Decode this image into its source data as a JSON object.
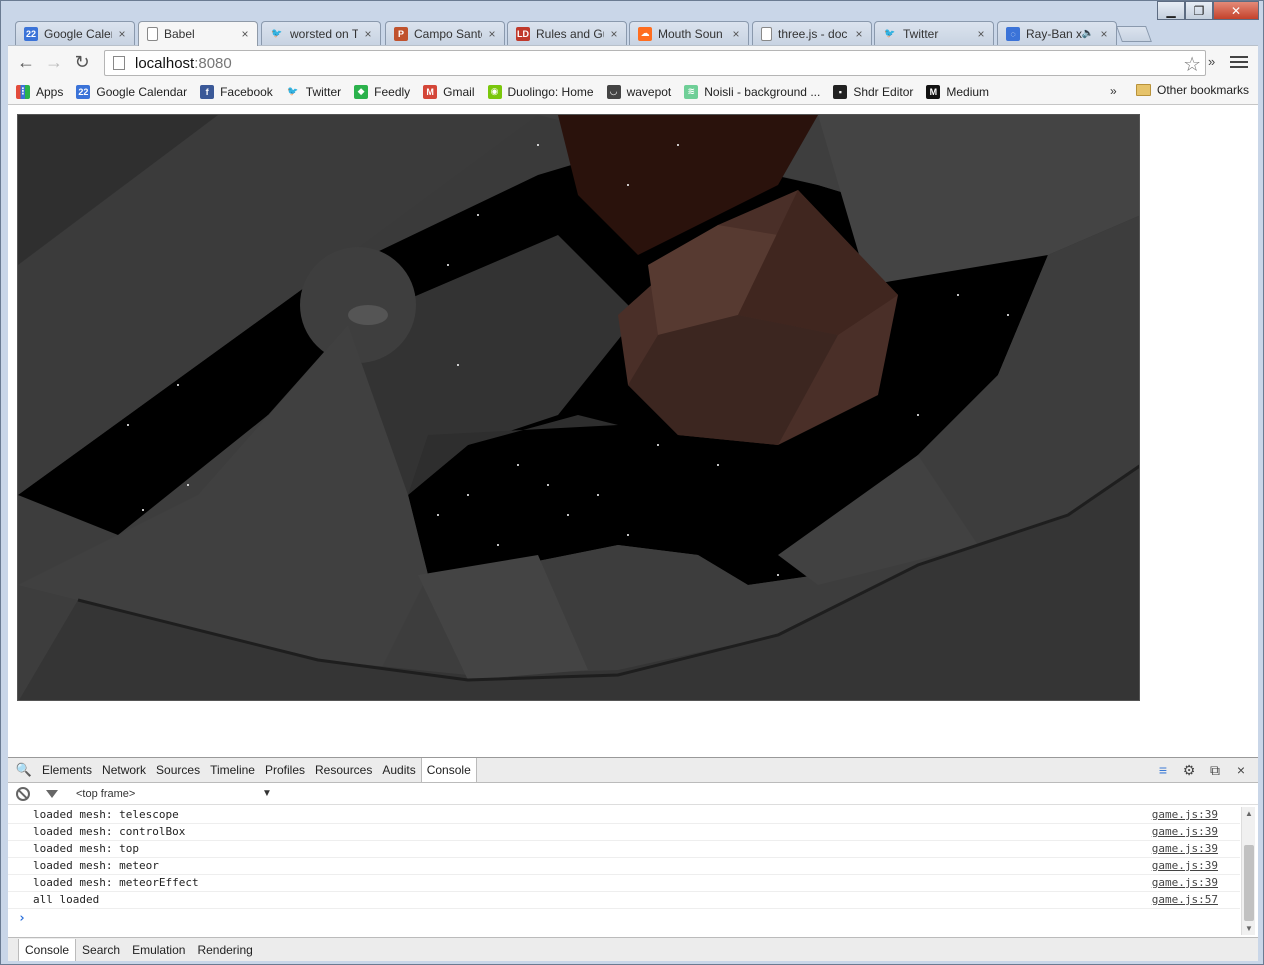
{
  "browser": {
    "tabs": [
      {
        "title": "Google Calen",
        "icon": "google-calendar-icon",
        "color": "#3b73d8",
        "glyph": "22",
        "active": false
      },
      {
        "title": "Babel",
        "icon": "page-icon",
        "color": "#ffffff",
        "glyph": "",
        "active": true
      },
      {
        "title": "worsted on T",
        "icon": "twitter-icon",
        "color": "#55acee",
        "glyph": "🐦",
        "active": false
      },
      {
        "title": "Campo Santo",
        "icon": "campo-santo-icon",
        "color": "#c0522d",
        "glyph": "P",
        "active": false
      },
      {
        "title": "Rules and Gu",
        "icon": "ludum-dare-icon",
        "color": "#c0392b",
        "glyph": "LD",
        "active": false
      },
      {
        "title": "Mouth Soun",
        "icon": "soundcloud-icon",
        "color": "#ff6d1f",
        "glyph": "☁",
        "active": false
      },
      {
        "title": "three.js - doc",
        "icon": "page-icon",
        "color": "#ffffff",
        "glyph": "",
        "active": false
      },
      {
        "title": "Twitter",
        "icon": "twitter-icon",
        "color": "#55acee",
        "glyph": "🐦",
        "active": false
      },
      {
        "title": "Ray-Ban x",
        "icon": "loading-icon",
        "color": "#3b73d8",
        "glyph": "◌",
        "active": false
      }
    ],
    "close_glyph": "×",
    "window_controls": {
      "minimize": "▁",
      "maximize": "❐",
      "close": "✕"
    },
    "nav": {
      "back": "←",
      "forward": "→",
      "reload": "↻"
    },
    "address": {
      "host": "localhost",
      "port": ":8080",
      "star": "☆"
    },
    "more": "»",
    "bookmarks": [
      {
        "label": "Apps",
        "icon": "apps-grid-icon",
        "color": "#e34c3c",
        "glyph": "⋮"
      },
      {
        "label": "Google Calendar",
        "icon": "google-calendar-icon",
        "color": "#3b73d8",
        "glyph": "22"
      },
      {
        "label": "Facebook",
        "icon": "facebook-icon",
        "color": "#3b5998",
        "glyph": "f"
      },
      {
        "label": "Twitter",
        "icon": "twitter-icon",
        "color": "#55acee",
        "glyph": "🐦"
      },
      {
        "label": "Feedly",
        "icon": "feedly-icon",
        "color": "#2bb24c",
        "glyph": "◆"
      },
      {
        "label": "Gmail",
        "icon": "gmail-icon",
        "color": "#d44638",
        "glyph": "M"
      },
      {
        "label": "Duolingo: Home",
        "icon": "duolingo-icon",
        "color": "#7ac70c",
        "glyph": "◉"
      },
      {
        "label": "wavepot",
        "icon": "wavepot-icon",
        "color": "#444444",
        "glyph": "◡"
      },
      {
        "label": "Noisli - background ...",
        "icon": "noisli-icon",
        "color": "#6fcf97",
        "glyph": "≋"
      },
      {
        "label": "Shdr Editor",
        "icon": "shdr-icon",
        "color": "#222222",
        "glyph": "▪"
      },
      {
        "label": "Medium",
        "icon": "medium-icon",
        "color": "#111111",
        "glyph": "M"
      }
    ],
    "bookmarks_more": "»",
    "other_bookmarks": "Other bookmarks"
  },
  "devtools": {
    "tabs": [
      "Elements",
      "Network",
      "Sources",
      "Timeline",
      "Profiles",
      "Resources",
      "Audits",
      "Console"
    ],
    "active_tab": "Console",
    "frame_selector": "<top frame>",
    "frame_arrow": "▼",
    "console_lines": [
      {
        "message": "loaded mesh: telescope",
        "source": "game.js:39"
      },
      {
        "message": "loaded mesh: controlBox",
        "source": "game.js:39"
      },
      {
        "message": "loaded mesh: top",
        "source": "game.js:39"
      },
      {
        "message": "loaded mesh: meteor",
        "source": "game.js:39"
      },
      {
        "message": "loaded mesh: meteorEffect",
        "source": "game.js:39"
      },
      {
        "message": "all loaded",
        "source": "game.js:57"
      }
    ],
    "prompt": "›",
    "drawer_tabs": [
      "Console",
      "Search",
      "Emulation",
      "Rendering"
    ],
    "drawer_active": "Console"
  }
}
